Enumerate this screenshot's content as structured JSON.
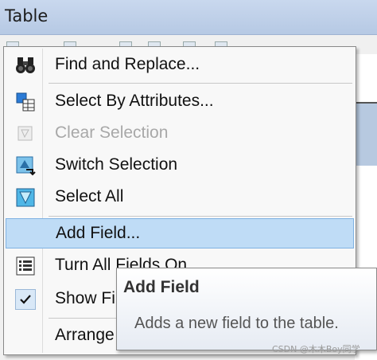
{
  "window": {
    "title": "Table"
  },
  "menu": {
    "items": [
      {
        "label": "Find and Replace...",
        "icon": "binoculars-icon",
        "enabled": true
      },
      {
        "label": "Select By Attributes...",
        "icon": "select-by-attributes-icon",
        "enabled": true
      },
      {
        "label": "Clear Selection",
        "icon": "clear-selection-icon",
        "enabled": false
      },
      {
        "label": "Switch Selection",
        "icon": "switch-selection-icon",
        "enabled": true
      },
      {
        "label": "Select All",
        "icon": "select-all-icon",
        "enabled": true
      },
      {
        "label": "Add Field...",
        "icon": "",
        "enabled": true,
        "highlighted": true
      },
      {
        "label": "Turn All Fields On",
        "icon": "fields-list-icon",
        "enabled": true
      },
      {
        "label": "Show Fi",
        "icon": "checkmark-icon",
        "enabled": true,
        "checked": true
      },
      {
        "label": "Arrange",
        "icon": "",
        "enabled": true
      }
    ]
  },
  "tooltip": {
    "title": "Add Field",
    "body": "Adds a new field to the table."
  },
  "watermark": "CSDN @木木Boy同学"
}
